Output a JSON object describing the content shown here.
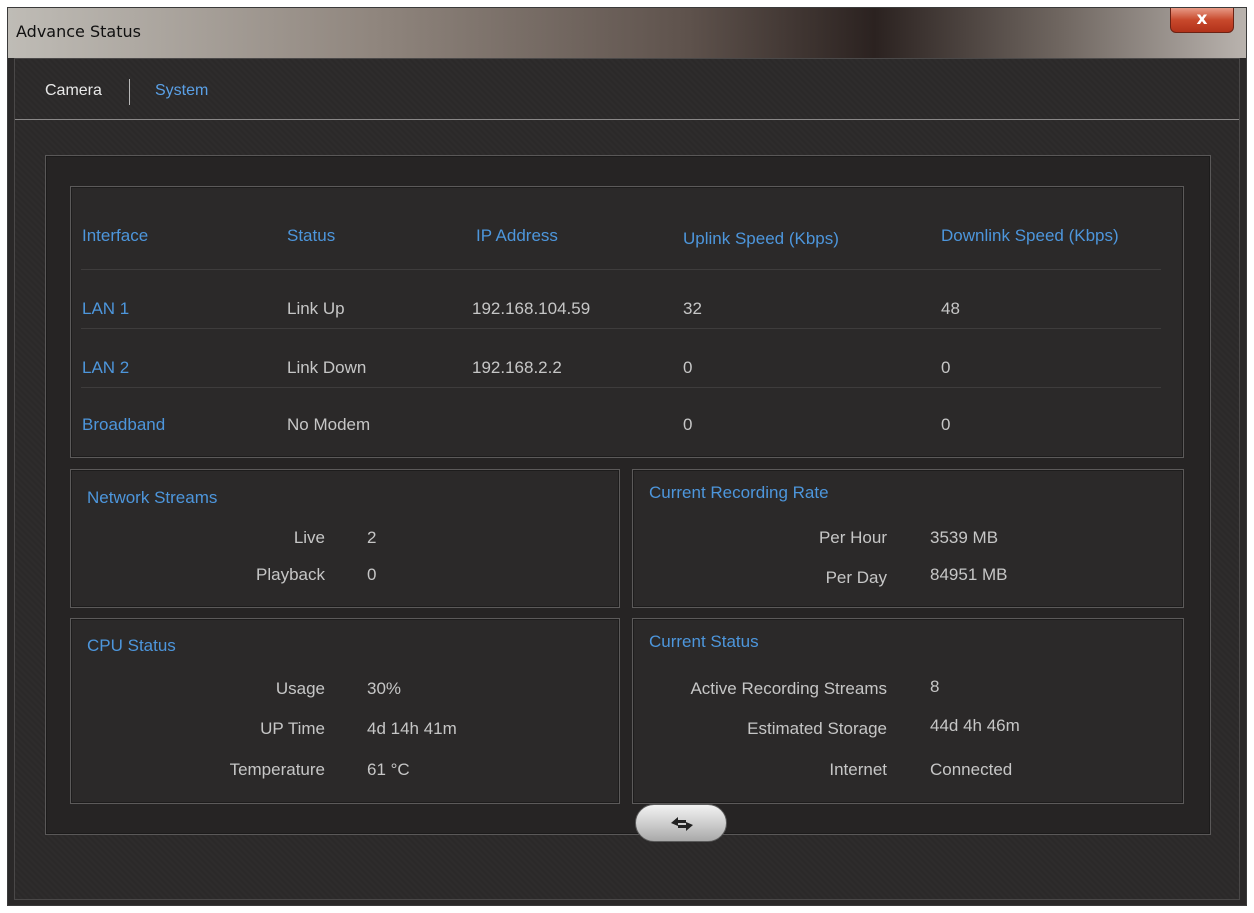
{
  "window": {
    "title": "Advance Status",
    "close_label": "x"
  },
  "tabs": [
    {
      "label": "Camera"
    },
    {
      "label": "System"
    }
  ],
  "interfaces": {
    "headers": [
      "Interface",
      "Status",
      "IP Address",
      "Uplink Speed (Kbps)",
      "Downlink Speed (Kbps)"
    ],
    "rows": [
      [
        "LAN 1",
        "Link Up",
        "192.168.104.59",
        "32",
        "48"
      ],
      [
        "LAN 2",
        "Link Down",
        "192.168.2.2",
        "0",
        "0"
      ],
      [
        "Broadband",
        "No Modem",
        "",
        "0",
        "0"
      ]
    ]
  },
  "network_streams": {
    "title": "Network Streams",
    "live_label": "Live",
    "live_value": "2",
    "playback_label": "Playback",
    "playback_value": "0"
  },
  "recording_rate": {
    "title": "Current Recording Rate",
    "per_hour_label": "Per Hour",
    "per_hour_value": "3539 MB",
    "per_day_label": "Per Day",
    "per_day_value": "84951 MB"
  },
  "cpu_status": {
    "title": "CPU Status",
    "usage_label": "Usage",
    "usage_value": "30%",
    "uptime_label": "UP Time",
    "uptime_value": "4d 14h 41m",
    "temp_label": "Temperature",
    "temp_value": "61 °C"
  },
  "current_status": {
    "title": "Current Status",
    "streams_label": "Active Recording Streams",
    "streams_value": "8",
    "storage_label": "Estimated Storage",
    "storage_value": "44d 4h 46m",
    "internet_label": "Internet",
    "internet_value": "Connected"
  },
  "refresh_icon": "refresh-arrows-icon",
  "colors": {
    "accent": "#4d96dc",
    "text": "#c6c6c6",
    "background": "#2b2929",
    "close": "#c8492c"
  }
}
